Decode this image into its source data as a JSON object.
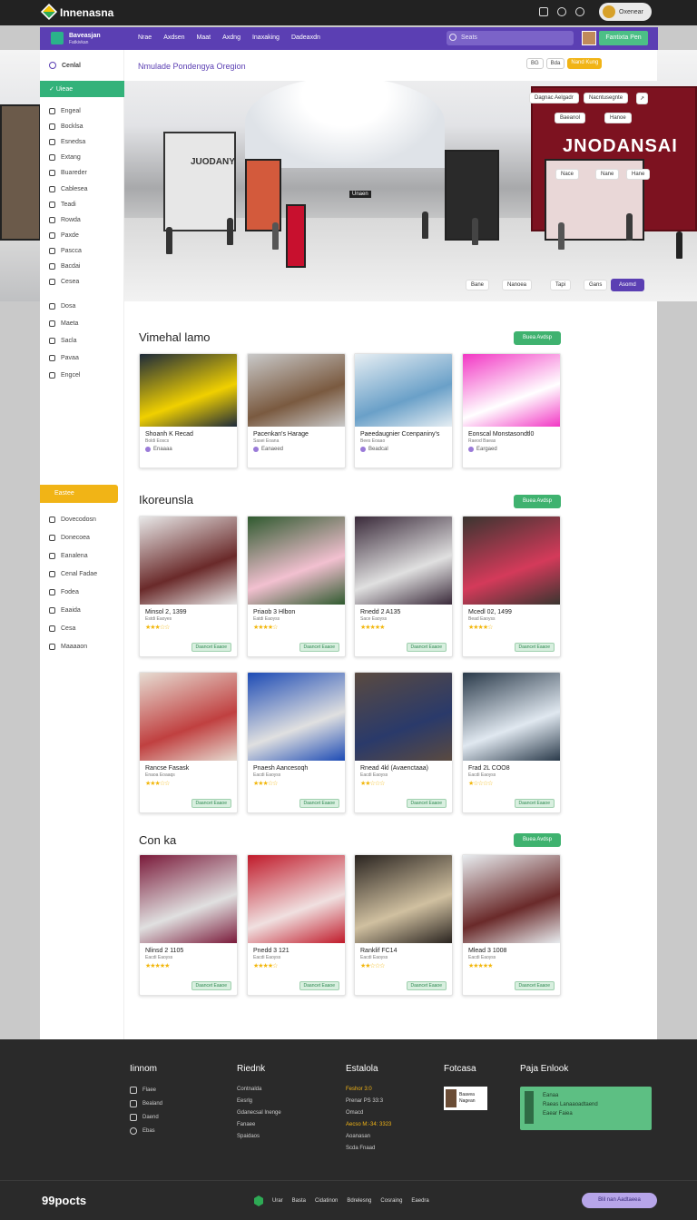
{
  "app": {
    "brand": "Innenasna",
    "user_label": "Oxenear"
  },
  "nav": {
    "title": "Baveasjan",
    "subtitle": "Fatkivkan",
    "links": [
      "Nrae",
      "Axdsen",
      "Maat",
      "Axdng",
      "Inaxaking",
      "Dadeaxdn"
    ],
    "search_placeholder": "Seats",
    "cta": "Fantixta Pen"
  },
  "location": {
    "title": "Nmulade Pondengya Oregion",
    "chips": [
      "BG",
      "Bda",
      "Nand Kung"
    ],
    "go_label": "Nand Kung"
  },
  "hero": {
    "tags_top": [
      "Dagnac Aelgadr",
      "Nacntusegnte"
    ],
    "tags_mid": [
      "Baeanol",
      "Hanoe"
    ],
    "tags_side": [
      "Nace",
      "Nane",
      "Hane"
    ],
    "store_sign": "JNODANSAI",
    "bottom_tags": [
      "Bane",
      "Nanoea",
      "Tapi",
      "Gans"
    ],
    "bottom_cta": "Asomd",
    "inner_sign": "Unaen",
    "left_sign": "JUODANY"
  },
  "sidebar": {
    "head": "Cenlal",
    "active": "Uieae",
    "items": [
      "Engeal",
      "Bocklsa",
      "Esnedsa",
      "Extang",
      "Buareder",
      "Cablesea",
      "Teadi",
      "Rowda",
      "Paxde",
      "Pascca",
      "Bacdai",
      "Cesea"
    ],
    "items2": [
      "Dosa",
      "Maeta",
      "Sacla",
      "Pavaa",
      "Engcel"
    ],
    "button": "Eastee",
    "items3": [
      "Dovecodosn",
      "Donecoea",
      "Eanalena",
      "Cenal Fadae",
      "Fodea",
      "Eaaida",
      "Cesa",
      "Maaaaon"
    ]
  },
  "sections": [
    {
      "title": "Vimehal lamo",
      "button": "Buea Avdsp"
    },
    {
      "title": "Ikoreunsla",
      "button": "Buea Avdsp"
    },
    {
      "title": "Con ka",
      "button": "Buea Avdsp"
    }
  ],
  "cards1": [
    {
      "title": "Shoanh K Recad",
      "sub": "Boldi Eoscs",
      "meta": "Enaaaa"
    },
    {
      "title": "Pacenkan's Harage",
      "sub": "Sasei Eoana",
      "meta": "Eanaeed"
    },
    {
      "title": "Paeedaugnier Ccenpaniny's",
      "sub": "Bees Eoaao",
      "meta": "Beadcal"
    },
    {
      "title": "Eonscal Monstasondtl0",
      "sub": "Raeod Baeas",
      "meta": "Eargaed"
    }
  ],
  "cards2": [
    {
      "title": "Minsol 2, 1399",
      "sub": "Estdi Eaoyes",
      "btn": "Daancet Eaaoe",
      "stars": "★★★☆☆"
    },
    {
      "title": "Priaob 3 Hlbon",
      "sub": "Eatdi Eaoyss",
      "btn": "Daancet Eaaoe",
      "stars": "★★★★☆"
    },
    {
      "title": "Rnedd 2 A135",
      "sub": "Sace Eaoyss",
      "btn": "Daancet Eaaoe",
      "stars": "★★★★★"
    },
    {
      "title": "Mcedl 02, 1499",
      "sub": "Bead Eaoyss",
      "btn": "Daancet Eaaoe",
      "stars": "★★★★☆"
    },
    {
      "title": "Rancse Fasask",
      "sub": "Enaoa Eoaaqs",
      "btn": "Daancet Eaaoe",
      "stars": "★★★☆☆"
    },
    {
      "title": "Pnaesh Aancesoqh",
      "sub": "Eacdi Eaoyss",
      "btn": "Daancet Eaaoe",
      "stars": "★★★☆☆"
    },
    {
      "title": "Rnead 4kl (Avaenctaaa)",
      "sub": "Eacdi Eaoyss",
      "btn": "Daancet Eaaoe",
      "stars": "★★☆☆☆"
    },
    {
      "title": "Frad 2L COO8",
      "sub": "Eacdi Eaoyss",
      "btn": "Daancet Eaaoe",
      "stars": "★☆☆☆☆"
    }
  ],
  "cards3": [
    {
      "title": "Nlinsd 2 1105",
      "sub": "Eacdi Eaoyss",
      "btn": "Daancet Eaaoe",
      "stars": "★★★★★"
    },
    {
      "title": "Pnedd 3 121",
      "sub": "Eacdi Eaoyss",
      "btn": "Daancet Eaaoe",
      "stars": "★★★★☆"
    },
    {
      "title": "Ranklif FC14",
      "sub": "Eacdi Eaoyss",
      "btn": "Daancet Eaaoe",
      "stars": "★★☆☆☆"
    },
    {
      "title": "Mlead 3 1008",
      "sub": "Eacdi Eaoyss",
      "btn": "Daancet Eaaoe",
      "stars": "★★★★★"
    }
  ],
  "footer": {
    "col1": {
      "title": "Iinnom",
      "items": [
        "Flaee",
        "Bealand",
        "Daend",
        "Ebas"
      ]
    },
    "col2": {
      "title": "Riednk",
      "items": [
        "Contnalda",
        "Eesrlg",
        "Gdanecsal Inenge",
        "Fanaee",
        "Spaidaos"
      ]
    },
    "col3": {
      "title": "Estalola",
      "items": [
        "Feshor 3:0",
        "Prenar PS 33:3",
        "Omacd",
        "Aecso M:-34: 3323",
        "Aoanasan",
        "Scda Fnaad"
      ]
    },
    "col4": {
      "title": "Fotcasa",
      "card_line1": "Baavea",
      "card_line2": "Nagean"
    },
    "col5": {
      "title": "Paja Enlook",
      "lines": [
        "Eanaa",
        "Raeas Lanaaoadtaend",
        "Eaear Faiea"
      ]
    }
  },
  "bottom": {
    "logo": "99pocts",
    "links": [
      "Urar",
      "Basta",
      "Cidatinon",
      "Bdrelesng",
      "Cosraing",
      "Eaedra"
    ],
    "cta": "Blil nan Aadtaeea"
  }
}
